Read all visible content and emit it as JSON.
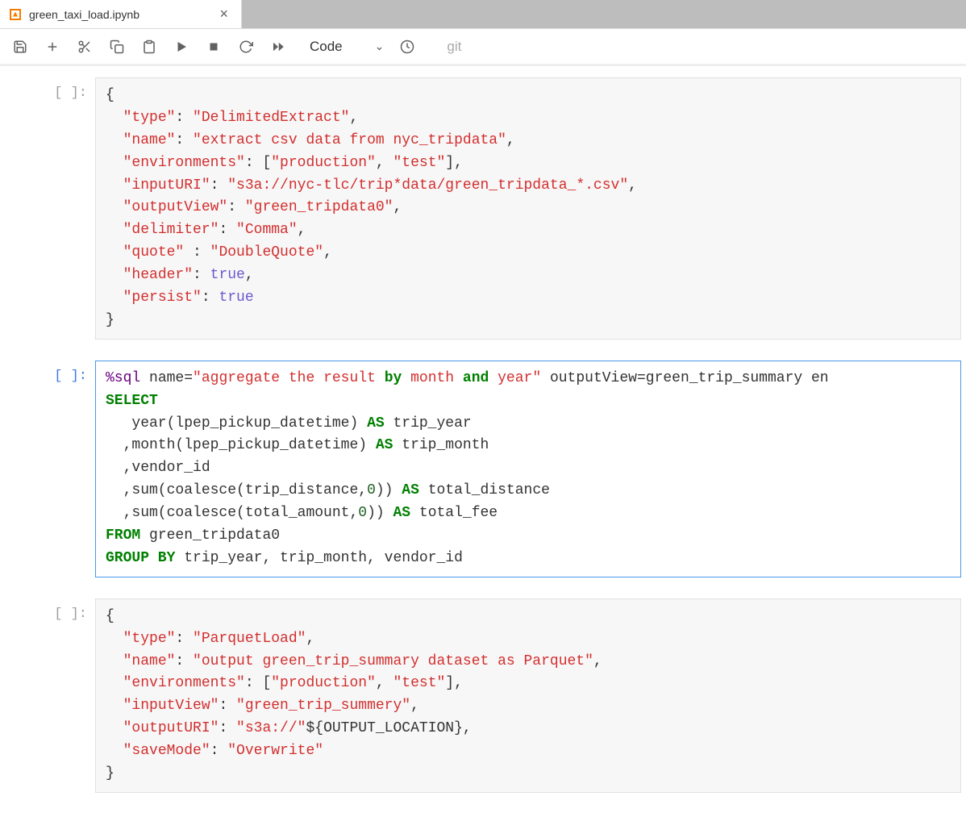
{
  "tab": {
    "title": "green_taxi_load.ipynb"
  },
  "toolbar": {
    "celltype": "Code",
    "git": "git"
  },
  "prompts": {
    "p1": "[ ]:",
    "p2": "[ ]:",
    "p3": "[ ]:"
  },
  "cell1": {
    "l1a": "{",
    "l2k": "\"type\"",
    "l2v": "\"DelimitedExtract\"",
    "l3k": "\"name\"",
    "l3v": "\"extract csv data from nyc_tripdata\"",
    "l4k": "\"environments\"",
    "l4v1": "\"production\"",
    "l4v2": "\"test\"",
    "l5k": "\"inputURI\"",
    "l5v": "\"s3a://nyc-tlc/trip*data/green_tripdata_*.csv\"",
    "l6k": "\"outputView\"",
    "l6v": "\"green_tripdata0\"",
    "l7k": "\"delimiter\"",
    "l7v": "\"Comma\"",
    "l8k": "\"quote\"",
    "l8v": "\"DoubleQuote\"",
    "l9k": "\"header\"",
    "l9v": "true",
    "l10k": "\"persist\"",
    "l10v": "true",
    "l11": "}"
  },
  "cell2": {
    "magic": "%sql",
    "attr_name_k": "name=",
    "attr_name_v": "\"aggregate the result ",
    "by": "by",
    "mid1": " month ",
    "and": "and",
    "mid2": " year\"",
    "attr_ov": " outputView=green_trip_summary en",
    "select": "SELECT",
    "l2": "   year(lpep_pickup_datetime) ",
    "as1": "AS",
    "l2b": " trip_year",
    "l3": "  ,month(lpep_pickup_datetime) ",
    "as2": "AS",
    "l3b": " trip_month",
    "l4": "  ,vendor_id",
    "l5a": "  ,sum(coalesce(trip_distance,",
    "z1": "0",
    "l5b": ")) ",
    "as3": "AS",
    "l5c": " total_distance",
    "l6a": "  ,sum(coalesce(total_amount,",
    "z2": "0",
    "l6b": ")) ",
    "as4": "AS",
    "l6c": " total_fee",
    "from": "FROM",
    "l7b": " green_tripdata0",
    "groupby": "GROUP BY",
    "l8b": " trip_year, trip_month, vendor_id"
  },
  "cell3": {
    "l1": "{",
    "l2k": "\"type\"",
    "l2v": "\"ParquetLoad\"",
    "l3k": "\"name\"",
    "l3v": "\"output green_trip_summary dataset as Parquet\"",
    "l4k": "\"environments\"",
    "l4v1": "\"production\"",
    "l4v2": "\"test\"",
    "l5k": "\"inputView\"",
    "l5v": "\"green_trip_summery\"",
    "l6k": "\"outputURI\"",
    "l6v": "\"s3a://\"",
    "l6x": "${OUTPUT_LOCATION},",
    "l7k": "\"saveMode\"",
    "l7v": "\"Overwrite\"",
    "l8": "}"
  }
}
